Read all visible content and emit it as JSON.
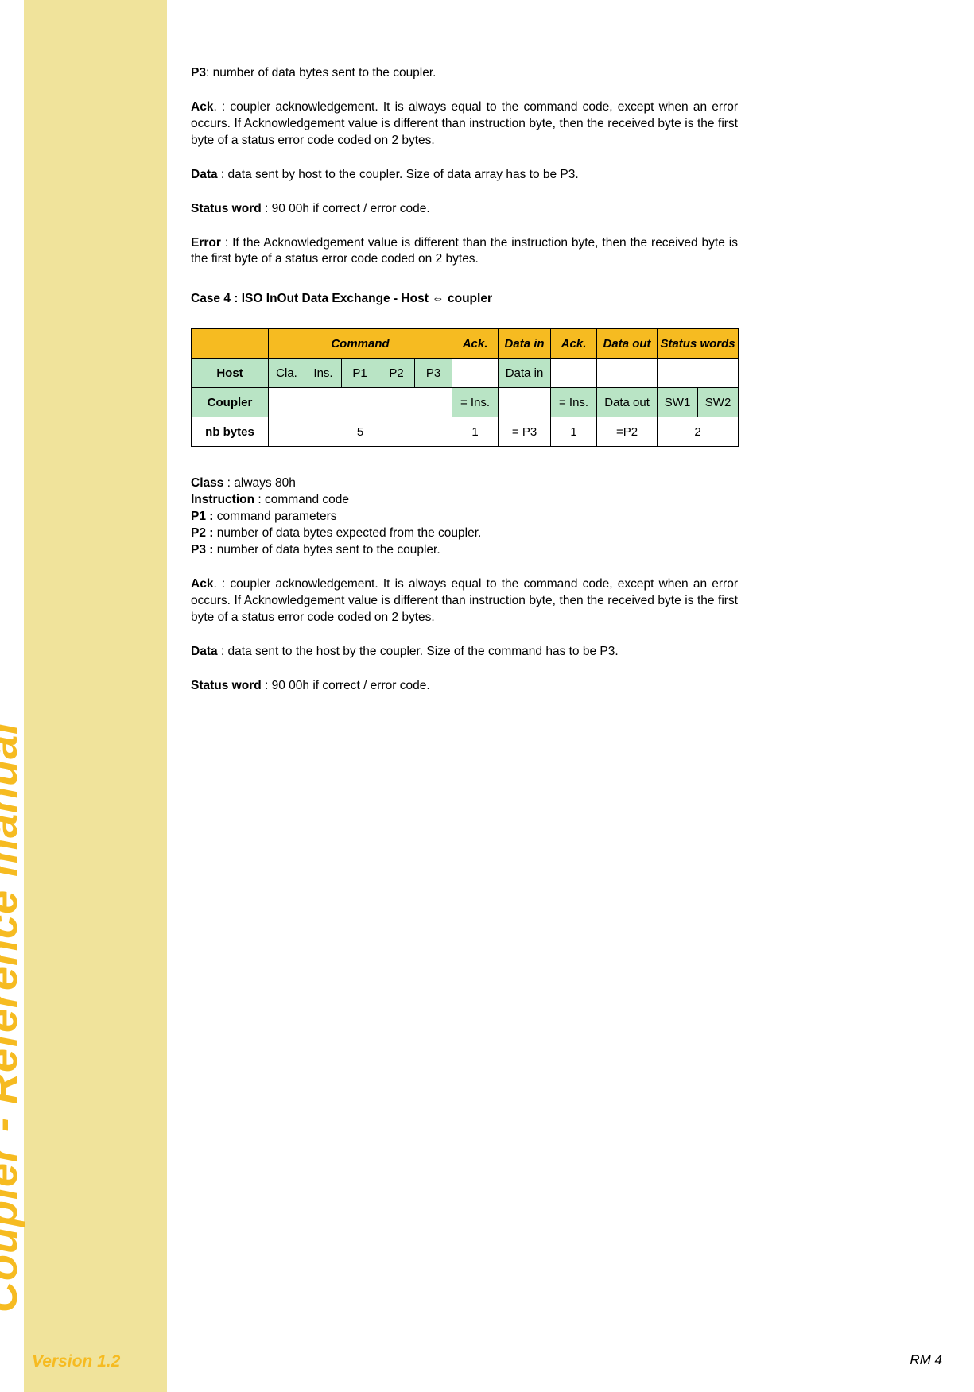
{
  "sidebar": {
    "title": "Coupler - Reference manual",
    "version": "Version 1.2"
  },
  "intro": {
    "p3": {
      "b": "P3",
      "t": ": number of data bytes sent to the coupler."
    },
    "ack": {
      "b": "Ack",
      "t": ". : coupler acknowledgement. It is always equal to the command code, except when an error occurs. If Acknowledgement value is different than instruction byte, then the received byte is the first byte of a status error code coded on 2 bytes."
    },
    "data": {
      "b": "Data",
      "t": " : data sent by host to the coupler. Size of data array has to be P3."
    },
    "status": {
      "b": "Status word",
      "t": " : 90 00h if correct / error code."
    },
    "error": {
      "b": "Error",
      "t": " : If the Acknowledgement value is different than the instruction byte, then the received byte is the first byte of a status error code coded on 2 bytes."
    }
  },
  "case4": {
    "heading": "Case 4 : ISO InOut Data Exchange - Host ⇔ coupler"
  },
  "table": {
    "headers": {
      "command": "Command",
      "ack1": "Ack.",
      "data_in": "Data in",
      "ack2": "Ack.",
      "data_out": "Data out",
      "status_words": "Status words"
    },
    "host": {
      "label": "Host",
      "cla": "Cla.",
      "ins": "Ins.",
      "p1": "P1",
      "p2": "P2",
      "p3": "P3",
      "data_in": "Data in"
    },
    "coupler": {
      "label": "Coupler",
      "ack1": "= Ins.",
      "ack2": "= Ins.",
      "data_out": "Data out",
      "sw1": "SW1",
      "sw2": "SW2"
    },
    "nb": {
      "label": "nb bytes",
      "cmd": "5",
      "ack1": "1",
      "data_in": "= P3",
      "ack2": "1",
      "data_out": "=P2",
      "sw": "2"
    }
  },
  "defs": {
    "class": {
      "b": "Class",
      "t": " : always 80h"
    },
    "instr": {
      "b": "Instruction",
      "t": " : command code"
    },
    "p1": {
      "b": "P1 :",
      "t": " command parameters"
    },
    "p2": {
      "b": "P2 :",
      "t": " number of data bytes expected from the coupler."
    },
    "p3": {
      "b": "P3 :",
      "t": " number of data bytes sent to the coupler."
    }
  },
  "after": {
    "ack": {
      "b": "Ack",
      "t": ". : coupler acknowledgement. It is always equal to the command code, except when an error occurs. If Acknowledgement value is different than instruction byte, then the received byte is the first byte of a status error code coded on 2 bytes."
    },
    "data": {
      "b": "Data",
      "t": " : data sent to the host by the coupler. Size of the command has to be P3."
    },
    "status": {
      "b": "Status word",
      "t": " : 90 00h if correct / error code."
    }
  },
  "page_num": "RM 4"
}
